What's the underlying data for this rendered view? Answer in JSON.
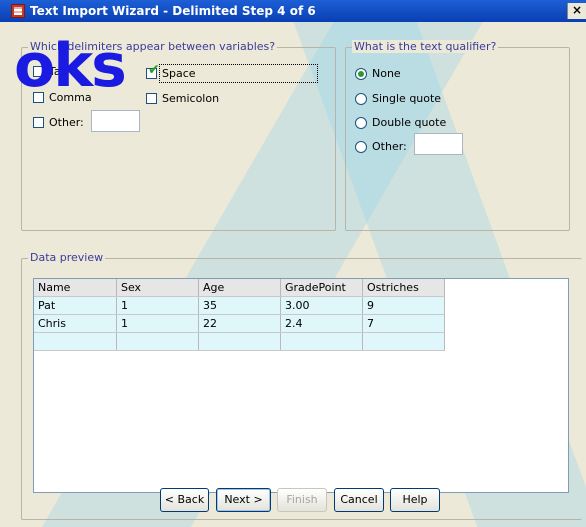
{
  "window": {
    "title": "Text Import Wizard - Delimited Step 4 of 6",
    "close": "×"
  },
  "delimiters": {
    "group_title": "Which delimiters appear between variables?",
    "tab": {
      "label": "Tab",
      "checked": false
    },
    "space": {
      "label": "Space",
      "checked": true
    },
    "comma": {
      "label": "Comma",
      "checked": false
    },
    "semicolon": {
      "label": "Semicolon",
      "checked": false
    },
    "other": {
      "label": "Other:",
      "checked": false,
      "value": ""
    },
    "tick": "✔"
  },
  "qualifier": {
    "group_title": "What is the text qualifier?",
    "none": {
      "label": "None",
      "selected": true
    },
    "single": {
      "label": "Single quote",
      "selected": false
    },
    "double": {
      "label": "Double quote",
      "selected": false
    },
    "other": {
      "label": "Other:",
      "selected": false,
      "value": ""
    }
  },
  "preview": {
    "group_title": "Data preview",
    "columns": [
      "Name",
      "Sex",
      "Age",
      "GradePoint",
      "Ostriches"
    ],
    "rows": [
      [
        "Pat",
        "1",
        "35",
        "3.00",
        "9"
      ],
      [
        "Chris",
        "1",
        "22",
        "2.4",
        "7"
      ],
      [
        "",
        "",
        "",
        "",
        ""
      ]
    ]
  },
  "buttons": {
    "back": "< Back",
    "next": "Next >",
    "finish": "Finish",
    "cancel": "Cancel",
    "help": "Help"
  },
  "watermark": "oks",
  "colors": {
    "title_bar": "#0a3fb3",
    "group_title": "#3b3b9a",
    "watermark": "#1a1ae0",
    "grid_row": "#dff6fa"
  }
}
